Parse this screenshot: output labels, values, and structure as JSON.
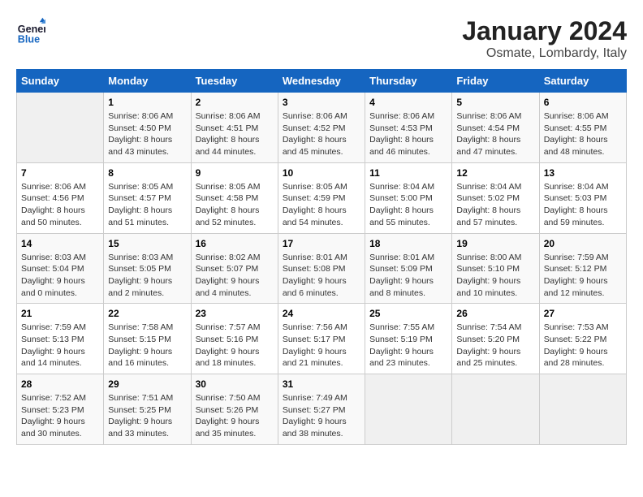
{
  "logo": {
    "line1": "General",
    "line2": "Blue"
  },
  "title": "January 2024",
  "subtitle": "Osmate, Lombardy, Italy",
  "days_of_week": [
    "Sunday",
    "Monday",
    "Tuesday",
    "Wednesday",
    "Thursday",
    "Friday",
    "Saturday"
  ],
  "weeks": [
    [
      {
        "day": "",
        "sunrise": "",
        "sunset": "",
        "daylight": ""
      },
      {
        "day": "1",
        "sunrise": "Sunrise: 8:06 AM",
        "sunset": "Sunset: 4:50 PM",
        "daylight": "Daylight: 8 hours and 43 minutes."
      },
      {
        "day": "2",
        "sunrise": "Sunrise: 8:06 AM",
        "sunset": "Sunset: 4:51 PM",
        "daylight": "Daylight: 8 hours and 44 minutes."
      },
      {
        "day": "3",
        "sunrise": "Sunrise: 8:06 AM",
        "sunset": "Sunset: 4:52 PM",
        "daylight": "Daylight: 8 hours and 45 minutes."
      },
      {
        "day": "4",
        "sunrise": "Sunrise: 8:06 AM",
        "sunset": "Sunset: 4:53 PM",
        "daylight": "Daylight: 8 hours and 46 minutes."
      },
      {
        "day": "5",
        "sunrise": "Sunrise: 8:06 AM",
        "sunset": "Sunset: 4:54 PM",
        "daylight": "Daylight: 8 hours and 47 minutes."
      },
      {
        "day": "6",
        "sunrise": "Sunrise: 8:06 AM",
        "sunset": "Sunset: 4:55 PM",
        "daylight": "Daylight: 8 hours and 48 minutes."
      }
    ],
    [
      {
        "day": "7",
        "sunrise": "Sunrise: 8:06 AM",
        "sunset": "Sunset: 4:56 PM",
        "daylight": "Daylight: 8 hours and 50 minutes."
      },
      {
        "day": "8",
        "sunrise": "Sunrise: 8:05 AM",
        "sunset": "Sunset: 4:57 PM",
        "daylight": "Daylight: 8 hours and 51 minutes."
      },
      {
        "day": "9",
        "sunrise": "Sunrise: 8:05 AM",
        "sunset": "Sunset: 4:58 PM",
        "daylight": "Daylight: 8 hours and 52 minutes."
      },
      {
        "day": "10",
        "sunrise": "Sunrise: 8:05 AM",
        "sunset": "Sunset: 4:59 PM",
        "daylight": "Daylight: 8 hours and 54 minutes."
      },
      {
        "day": "11",
        "sunrise": "Sunrise: 8:04 AM",
        "sunset": "Sunset: 5:00 PM",
        "daylight": "Daylight: 8 hours and 55 minutes."
      },
      {
        "day": "12",
        "sunrise": "Sunrise: 8:04 AM",
        "sunset": "Sunset: 5:02 PM",
        "daylight": "Daylight: 8 hours and 57 minutes."
      },
      {
        "day": "13",
        "sunrise": "Sunrise: 8:04 AM",
        "sunset": "Sunset: 5:03 PM",
        "daylight": "Daylight: 8 hours and 59 minutes."
      }
    ],
    [
      {
        "day": "14",
        "sunrise": "Sunrise: 8:03 AM",
        "sunset": "Sunset: 5:04 PM",
        "daylight": "Daylight: 9 hours and 0 minutes."
      },
      {
        "day": "15",
        "sunrise": "Sunrise: 8:03 AM",
        "sunset": "Sunset: 5:05 PM",
        "daylight": "Daylight: 9 hours and 2 minutes."
      },
      {
        "day": "16",
        "sunrise": "Sunrise: 8:02 AM",
        "sunset": "Sunset: 5:07 PM",
        "daylight": "Daylight: 9 hours and 4 minutes."
      },
      {
        "day": "17",
        "sunrise": "Sunrise: 8:01 AM",
        "sunset": "Sunset: 5:08 PM",
        "daylight": "Daylight: 9 hours and 6 minutes."
      },
      {
        "day": "18",
        "sunrise": "Sunrise: 8:01 AM",
        "sunset": "Sunset: 5:09 PM",
        "daylight": "Daylight: 9 hours and 8 minutes."
      },
      {
        "day": "19",
        "sunrise": "Sunrise: 8:00 AM",
        "sunset": "Sunset: 5:10 PM",
        "daylight": "Daylight: 9 hours and 10 minutes."
      },
      {
        "day": "20",
        "sunrise": "Sunrise: 7:59 AM",
        "sunset": "Sunset: 5:12 PM",
        "daylight": "Daylight: 9 hours and 12 minutes."
      }
    ],
    [
      {
        "day": "21",
        "sunrise": "Sunrise: 7:59 AM",
        "sunset": "Sunset: 5:13 PM",
        "daylight": "Daylight: 9 hours and 14 minutes."
      },
      {
        "day": "22",
        "sunrise": "Sunrise: 7:58 AM",
        "sunset": "Sunset: 5:15 PM",
        "daylight": "Daylight: 9 hours and 16 minutes."
      },
      {
        "day": "23",
        "sunrise": "Sunrise: 7:57 AM",
        "sunset": "Sunset: 5:16 PM",
        "daylight": "Daylight: 9 hours and 18 minutes."
      },
      {
        "day": "24",
        "sunrise": "Sunrise: 7:56 AM",
        "sunset": "Sunset: 5:17 PM",
        "daylight": "Daylight: 9 hours and 21 minutes."
      },
      {
        "day": "25",
        "sunrise": "Sunrise: 7:55 AM",
        "sunset": "Sunset: 5:19 PM",
        "daylight": "Daylight: 9 hours and 23 minutes."
      },
      {
        "day": "26",
        "sunrise": "Sunrise: 7:54 AM",
        "sunset": "Sunset: 5:20 PM",
        "daylight": "Daylight: 9 hours and 25 minutes."
      },
      {
        "day": "27",
        "sunrise": "Sunrise: 7:53 AM",
        "sunset": "Sunset: 5:22 PM",
        "daylight": "Daylight: 9 hours and 28 minutes."
      }
    ],
    [
      {
        "day": "28",
        "sunrise": "Sunrise: 7:52 AM",
        "sunset": "Sunset: 5:23 PM",
        "daylight": "Daylight: 9 hours and 30 minutes."
      },
      {
        "day": "29",
        "sunrise": "Sunrise: 7:51 AM",
        "sunset": "Sunset: 5:25 PM",
        "daylight": "Daylight: 9 hours and 33 minutes."
      },
      {
        "day": "30",
        "sunrise": "Sunrise: 7:50 AM",
        "sunset": "Sunset: 5:26 PM",
        "daylight": "Daylight: 9 hours and 35 minutes."
      },
      {
        "day": "31",
        "sunrise": "Sunrise: 7:49 AM",
        "sunset": "Sunset: 5:27 PM",
        "daylight": "Daylight: 9 hours and 38 minutes."
      },
      {
        "day": "",
        "sunrise": "",
        "sunset": "",
        "daylight": ""
      },
      {
        "day": "",
        "sunrise": "",
        "sunset": "",
        "daylight": ""
      },
      {
        "day": "",
        "sunrise": "",
        "sunset": "",
        "daylight": ""
      }
    ]
  ]
}
